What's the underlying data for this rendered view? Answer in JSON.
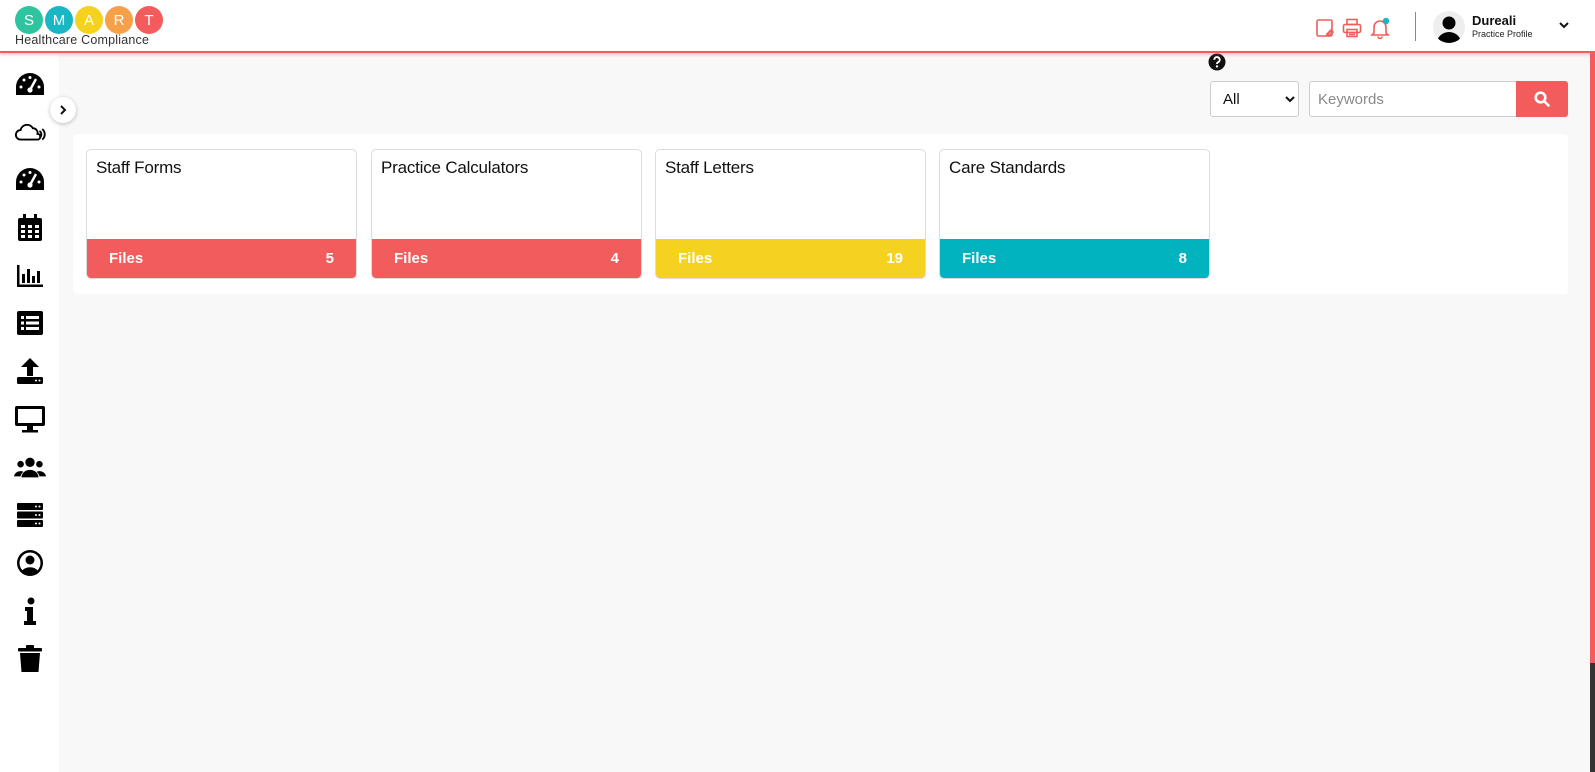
{
  "brand": {
    "letters": [
      "S",
      "M",
      "A",
      "R",
      "T"
    ],
    "letter_colors": [
      "#2ec4a0",
      "#19b6c4",
      "#f5d21f",
      "#f7a04a",
      "#f25c5c"
    ],
    "subtitle": "Healthcare Compliance"
  },
  "header": {
    "icons": [
      "notes-icon",
      "print-icon",
      "bell-icon"
    ],
    "user": {
      "name": "Dureali",
      "role": "Practice Profile"
    }
  },
  "sidebar": {
    "items": [
      "dashboard-icon",
      "cloud-icon",
      "dashboard-icon",
      "calendar-icon",
      "chart-icon",
      "list-icon",
      "upload-icon",
      "monitor-icon",
      "users-icon",
      "server-icon",
      "user-circle-icon",
      "info-icon",
      "trash-icon"
    ]
  },
  "search": {
    "filter_options": [
      "All"
    ],
    "filter_selected": "All",
    "placeholder": "Keywords"
  },
  "cards": [
    {
      "title": "Staff Forms",
      "footer_label": "Files",
      "count": "5",
      "color": "#f25c5c"
    },
    {
      "title": "Practice Calculators",
      "footer_label": "Files",
      "count": "4",
      "color": "#f25c5c"
    },
    {
      "title": "Staff Letters",
      "footer_label": "Files",
      "count": "19",
      "color": "#f5d21f"
    },
    {
      "title": "Care Standards",
      "footer_label": "Files",
      "count": "8",
      "color": "#00b3be"
    }
  ],
  "accent_color": "#f25c5c"
}
